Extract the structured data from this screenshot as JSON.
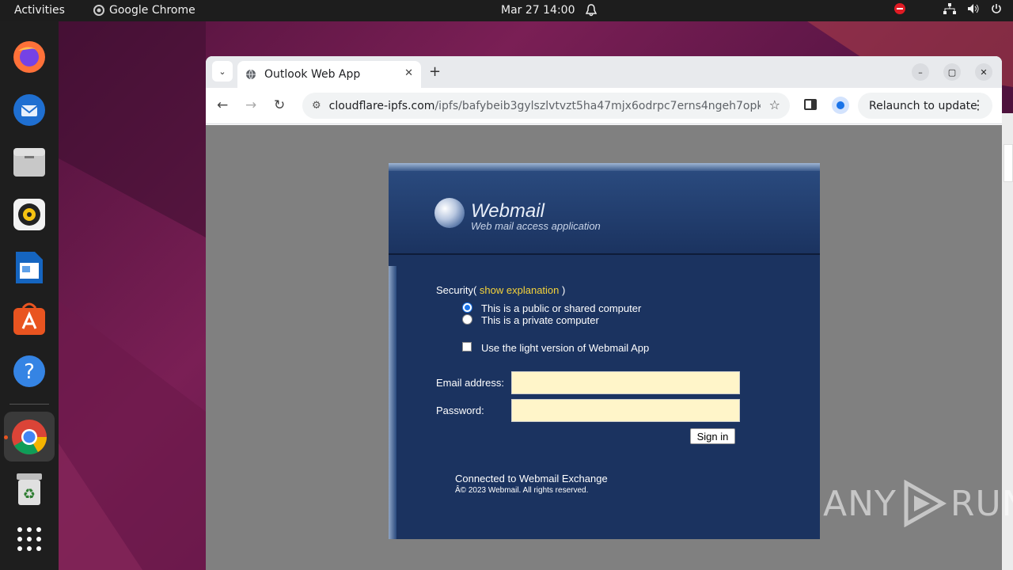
{
  "topbar": {
    "activities": "Activities",
    "app_name": "Google Chrome",
    "clock": "Mar 27  14:00"
  },
  "browser": {
    "tab_title": "Outlook Web App",
    "url_host": "cloudflare-ipfs.com",
    "url_path": "/ipfs/bafybeib3gylszlvtvzt5ha47mjx6odrpc7erns4ngeh7opkm7kl...",
    "relaunch_label": "Relaunch to update"
  },
  "webmail": {
    "title": "Webmail",
    "subtitle": "Web mail access application",
    "security_label": "Security(",
    "security_link": "show explanation",
    "security_close": ")",
    "radio_public": "This is a public or shared computer",
    "radio_private": "This is a private computer",
    "light_version": "Use the light version of Webmail App",
    "email_label": "Email address:",
    "password_label": "Password:",
    "email_value": "",
    "password_value": "",
    "signin_label": "Sign in",
    "connected": "Connected to Webmail Exchange",
    "copyright": "Â© 2023 Webmail. All rights reserved."
  },
  "watermark": {
    "left": "ANY",
    "right": "RUN"
  },
  "colors": {
    "panel_bg": "#1b3360",
    "link": "#f5d33a",
    "field_bg": "#fff5c9",
    "viewport_bg": "#808080"
  }
}
